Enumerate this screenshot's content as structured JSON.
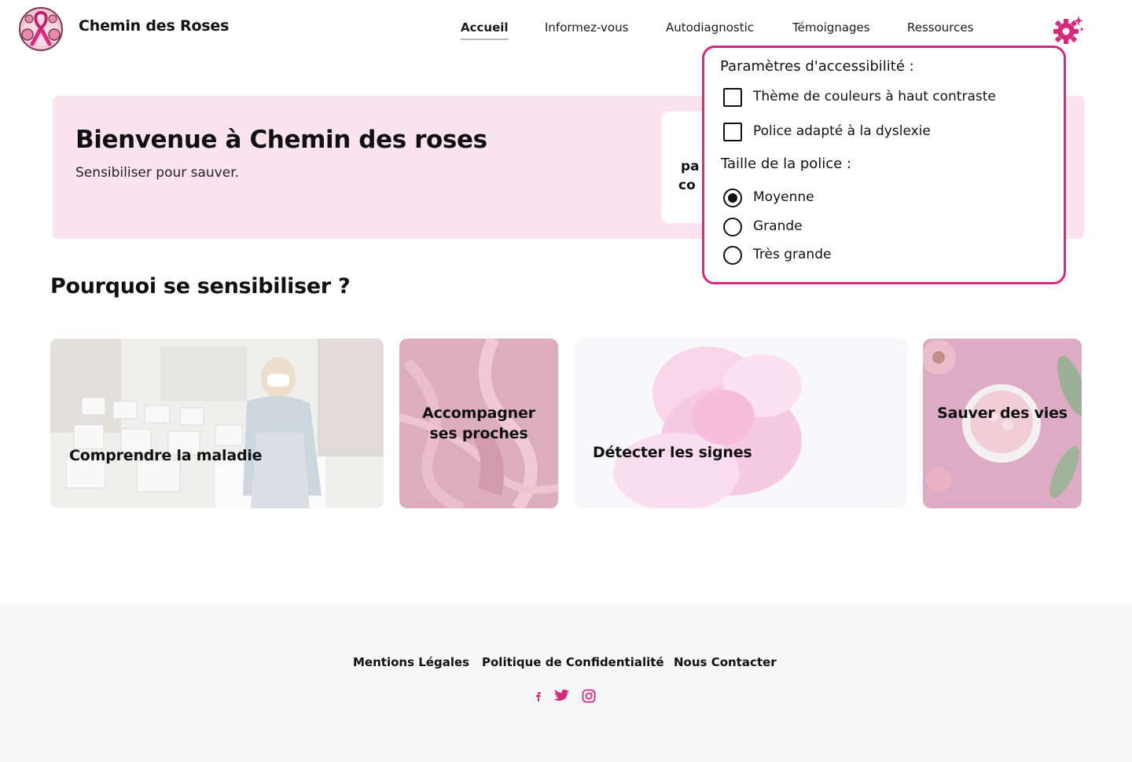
{
  "header": {
    "site_title": "Chemin des Roses",
    "logo_icon": "pink-ribbon-rose-logo",
    "nav": [
      {
        "label": "Accueil",
        "active": true
      },
      {
        "label": "Informez-vous",
        "active": false
      },
      {
        "label": "Autodiagnostic",
        "active": false
      },
      {
        "label": "Témoignages",
        "active": false
      },
      {
        "label": "Ressources",
        "active": false
      }
    ],
    "settings_icon": "gear-sparkle-icon"
  },
  "hero": {
    "title": "Bienvenue à Chemin des roses",
    "subtitle": "Sensibiliser pour sauver.",
    "card_line1": "pa",
    "card_line2": "co"
  },
  "section": {
    "title": "Pourquoi se sensibiliser ?"
  },
  "cards": [
    {
      "label": "Comprendre la maladie"
    },
    {
      "label": "Accompagner ses proches"
    },
    {
      "label": "Détecter les signes"
    },
    {
      "label": "Sauver des vies"
    }
  ],
  "footer": {
    "links": [
      "Mentions Légales",
      "Politique de Confidentialité",
      "Nous Contacter"
    ],
    "social": [
      "facebook-icon",
      "twitter-icon",
      "instagram-icon"
    ]
  },
  "accessibility": {
    "title": "Paramètres d'accessibilité :",
    "checkboxes": [
      {
        "label": "Thème de couleurs à haut contraste",
        "checked": false
      },
      {
        "label": "Police adapté à la dyslexie",
        "checked": false
      }
    ],
    "font_size_title": "Taille de la police :",
    "font_sizes": [
      {
        "label": "Moyenne",
        "selected": true
      },
      {
        "label": "Grande",
        "selected": false
      },
      {
        "label": "Très grande",
        "selected": false
      }
    ]
  },
  "colors": {
    "accent": "#d62a7f",
    "hero_bg": "#fce4ef",
    "footer_bg": "#f7f7f7"
  }
}
